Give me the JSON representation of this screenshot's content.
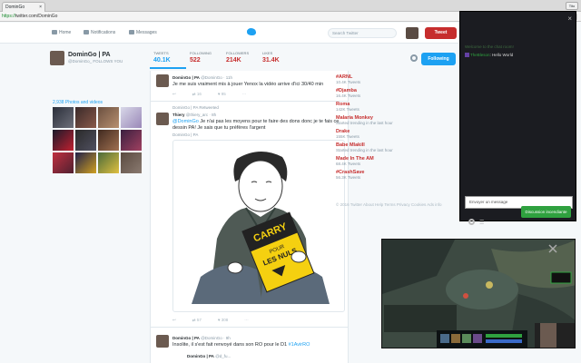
{
  "browser": {
    "tab_title": "DominGo",
    "tab_close": "×",
    "user_chip": "Tito",
    "url_scheme": "https://",
    "url_rest": "twitter.com/DominGo",
    "extension_colors": [
      "#e63b2e",
      "#f5b400",
      "#d0d0d0"
    ]
  },
  "twitter_nav": {
    "home": "Home",
    "notifications": "Notifications",
    "messages": "Messages",
    "search_placeholder": "Search Twitter",
    "tweet_button": "Tweet"
  },
  "profile": {
    "name": "DominGo | PA",
    "handle": "@DominGo_  FOLLOWS YOU",
    "stats": [
      {
        "label": "TWEETS",
        "value": "40.1K"
      },
      {
        "label": "FOLLOWING",
        "value": "522"
      },
      {
        "label": "FOLLOWERS",
        "value": "214K"
      },
      {
        "label": "LIKES",
        "value": "31.4K"
      }
    ],
    "follow_button": "Following",
    "photos_title": "2,938 Photos and videos"
  },
  "tweets": [
    {
      "name": "DominGo | PA",
      "handle": "@DominGo · 11h",
      "text": "Je me suis vraiment mis à jouer Yenox la vidéo arrive d'ici 30/40 min",
      "replies": "",
      "retweets": "16",
      "likes": "95"
    },
    {
      "retweet_label": "DominGo | PA Retweeted",
      "name": "Thiery",
      "handle": "@thiery_arc · 8h",
      "text_mention": "@DominGo",
      "text": " Je n'ai pas les moyens pour te faire des dons donc je te fais ce dessin PA! Je sais que tu préfères l'argent",
      "sub": "DominGo | PA",
      "replies": "",
      "retweets": "57",
      "likes": "308"
    },
    {
      "name": "DominGo | PA",
      "handle": "@DominGo · 9h",
      "text": "Insolite, il s'est fait renvoyé dans son RO pour le D1 ",
      "hashtag": "#1AvirRO",
      "quote_name": "DominGo | PA",
      "quote_handle": "@d_fu..."
    }
  ],
  "book": {
    "line1": "CARRY",
    "line2": "POUR",
    "line3": "LES NULS"
  },
  "trends": [
    {
      "name": "#ARNL",
      "count": "10.4K Tweets"
    },
    {
      "name": "#Djamba",
      "count": "16.4K Tweets"
    },
    {
      "name": "Roma",
      "count": "142K Tweets"
    },
    {
      "name": "Malaria Monkey",
      "count": "Started trending in the last hour"
    },
    {
      "name": "Drake",
      "count": "155K Tweets"
    },
    {
      "name": "Babe Mlakill",
      "count": "Started trending in the last hour"
    },
    {
      "name": "Made In The AM",
      "count": "68.4K Tweets"
    },
    {
      "name": "#CrashSave",
      "count": "56.3K Tweets"
    }
  ],
  "footer": "© 2016 Twitter  About  Help  Terms  Privacy  Cookies  Ads info",
  "chat": {
    "close": "×",
    "welcome": "Welcome to the chat room!",
    "msg_user": "TheBleson",
    "msg_text": ": Hello World",
    "input_placeholder": "Envoyer un message",
    "send_button": "Discussion incendiante"
  }
}
